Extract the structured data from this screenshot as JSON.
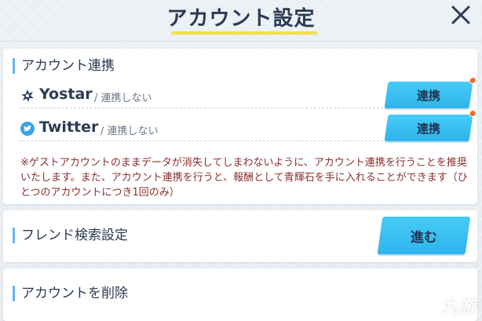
{
  "header": {
    "title": "アカウント設定",
    "close_icon": "close-icon"
  },
  "account_link": {
    "section_title": "アカウント連携",
    "services": [
      {
        "name": "Yostar",
        "icon": "yostar-icon",
        "status": "/ 連携しない",
        "button_label": "連携"
      },
      {
        "name": "Twitter",
        "icon": "twitter-bird-icon",
        "status": "/ 連携しない",
        "button_label": "連携"
      }
    ],
    "notice": "※ゲストアカウントのままデータが消失してしまわないように、アカウント連携を行うことを推奨いたします。また、アカウント連携を行うと、報酬として青輝石を手に入れることができます（ひとつのアカウントにつき1回のみ）"
  },
  "friend_search": {
    "section_title": "フレンド検索設定",
    "button_label": "進む"
  },
  "delete_account": {
    "section_title": "アカウントを削除"
  },
  "watermark": {
    "text": "九游"
  },
  "colors": {
    "accent_blue": "#2fb3ec",
    "title_underline": "#f2e04a",
    "notice_text": "#8a2e2e",
    "notify_dot": "#f26b2a"
  }
}
